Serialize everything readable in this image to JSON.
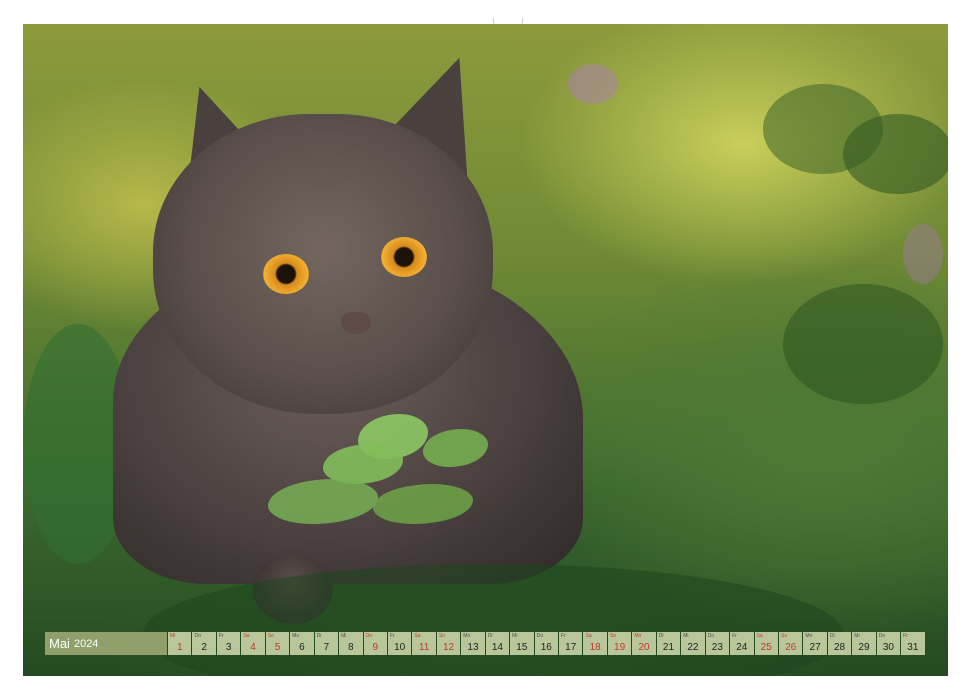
{
  "calendar": {
    "month": "Mai",
    "year": "2024",
    "days": [
      {
        "wd": "Mi",
        "num": "1",
        "red": true
      },
      {
        "wd": "Do",
        "num": "2",
        "red": false
      },
      {
        "wd": "Fr",
        "num": "3",
        "red": false
      },
      {
        "wd": "Sa",
        "num": "4",
        "red": true
      },
      {
        "wd": "So",
        "num": "5",
        "red": true
      },
      {
        "wd": "Mo",
        "num": "6",
        "red": false
      },
      {
        "wd": "Di",
        "num": "7",
        "red": false
      },
      {
        "wd": "Mi",
        "num": "8",
        "red": false
      },
      {
        "wd": "Do",
        "num": "9",
        "red": true
      },
      {
        "wd": "Fr",
        "num": "10",
        "red": false
      },
      {
        "wd": "Sa",
        "num": "11",
        "red": true
      },
      {
        "wd": "So",
        "num": "12",
        "red": true
      },
      {
        "wd": "Mo",
        "num": "13",
        "red": false
      },
      {
        "wd": "Di",
        "num": "14",
        "red": false
      },
      {
        "wd": "Mi",
        "num": "15",
        "red": false
      },
      {
        "wd": "Do",
        "num": "16",
        "red": false
      },
      {
        "wd": "Fr",
        "num": "17",
        "red": false
      },
      {
        "wd": "Sa",
        "num": "18",
        "red": true
      },
      {
        "wd": "So",
        "num": "19",
        "red": true
      },
      {
        "wd": "Mo",
        "num": "20",
        "red": true
      },
      {
        "wd": "Di",
        "num": "21",
        "red": false
      },
      {
        "wd": "Mi",
        "num": "22",
        "red": false
      },
      {
        "wd": "Do",
        "num": "23",
        "red": false
      },
      {
        "wd": "Fr",
        "num": "24",
        "red": false
      },
      {
        "wd": "Sa",
        "num": "25",
        "red": true
      },
      {
        "wd": "So",
        "num": "26",
        "red": true
      },
      {
        "wd": "Mo",
        "num": "27",
        "red": false
      },
      {
        "wd": "Di",
        "num": "28",
        "red": false
      },
      {
        "wd": "Mi",
        "num": "29",
        "red": false
      },
      {
        "wd": "Do",
        "num": "30",
        "red": false
      },
      {
        "wd": "Fr",
        "num": "31",
        "red": false
      }
    ]
  },
  "colors": {
    "bar_label_bg": "#8fa06a",
    "day_cell_bg": "#b9c69a",
    "holiday_text": "#c0392b"
  }
}
